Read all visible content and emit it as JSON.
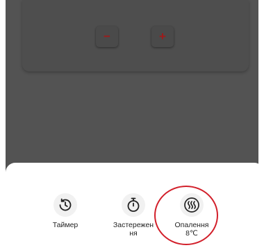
{
  "controls": {
    "minus_label": "−",
    "plus_label": "+"
  },
  "actions": [
    {
      "id": "timer",
      "label": "Таймер",
      "icon": "timer-icon"
    },
    {
      "id": "warning",
      "label": "Застереження",
      "icon": "stopwatch-icon"
    },
    {
      "id": "heating",
      "label": "Опалення",
      "value": "8℃",
      "icon": "heating-icon"
    }
  ],
  "colors": {
    "overlay": "#535353",
    "card": "#4e4e4e",
    "accent_dim": "#a01a1a",
    "highlight": "#d21f2a"
  }
}
